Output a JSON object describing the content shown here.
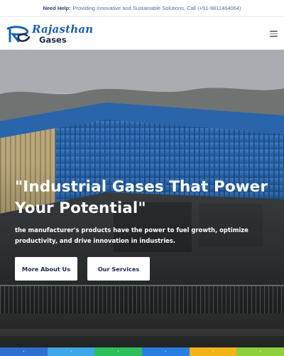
{
  "topbar": {
    "help_label": "Need Help:",
    "help_text": "Providing Innovative and Sustainable Solutions, Call (+91-9811464064)"
  },
  "header": {
    "brand_line1": "Rajasthan",
    "brand_line2": "Gases",
    "logo_mark": "RG",
    "menu_icon": "hamburger-icon"
  },
  "hero": {
    "title": "\"Industrial Gases That Power Your Potential\"",
    "subtitle": "the manufacturer's products have the power to fuel growth, optimize productivity, and drive innovation in industries.",
    "buttons": [
      {
        "label": "More About Us"
      },
      {
        "label": "Our Services"
      }
    ]
  },
  "footer_strip": {
    "segments": [
      {
        "color": "#2f6fd1",
        "icon": "facebook-icon"
      },
      {
        "color": "#3ea7e6",
        "icon": "twitter-icon"
      },
      {
        "color": "#2fbf5a",
        "icon": "whatsapp-icon"
      },
      {
        "color": "#2a7de0",
        "icon": "linkedin-icon"
      },
      {
        "color": "#f3b41a",
        "icon": "phone-icon"
      },
      {
        "color": "#8fce3c",
        "icon": "email-icon"
      }
    ]
  },
  "colors": {
    "brand_blue": "#1a5fb4",
    "brand_dark": "#1c2a4a",
    "building_blue": "#2f6fb8"
  }
}
